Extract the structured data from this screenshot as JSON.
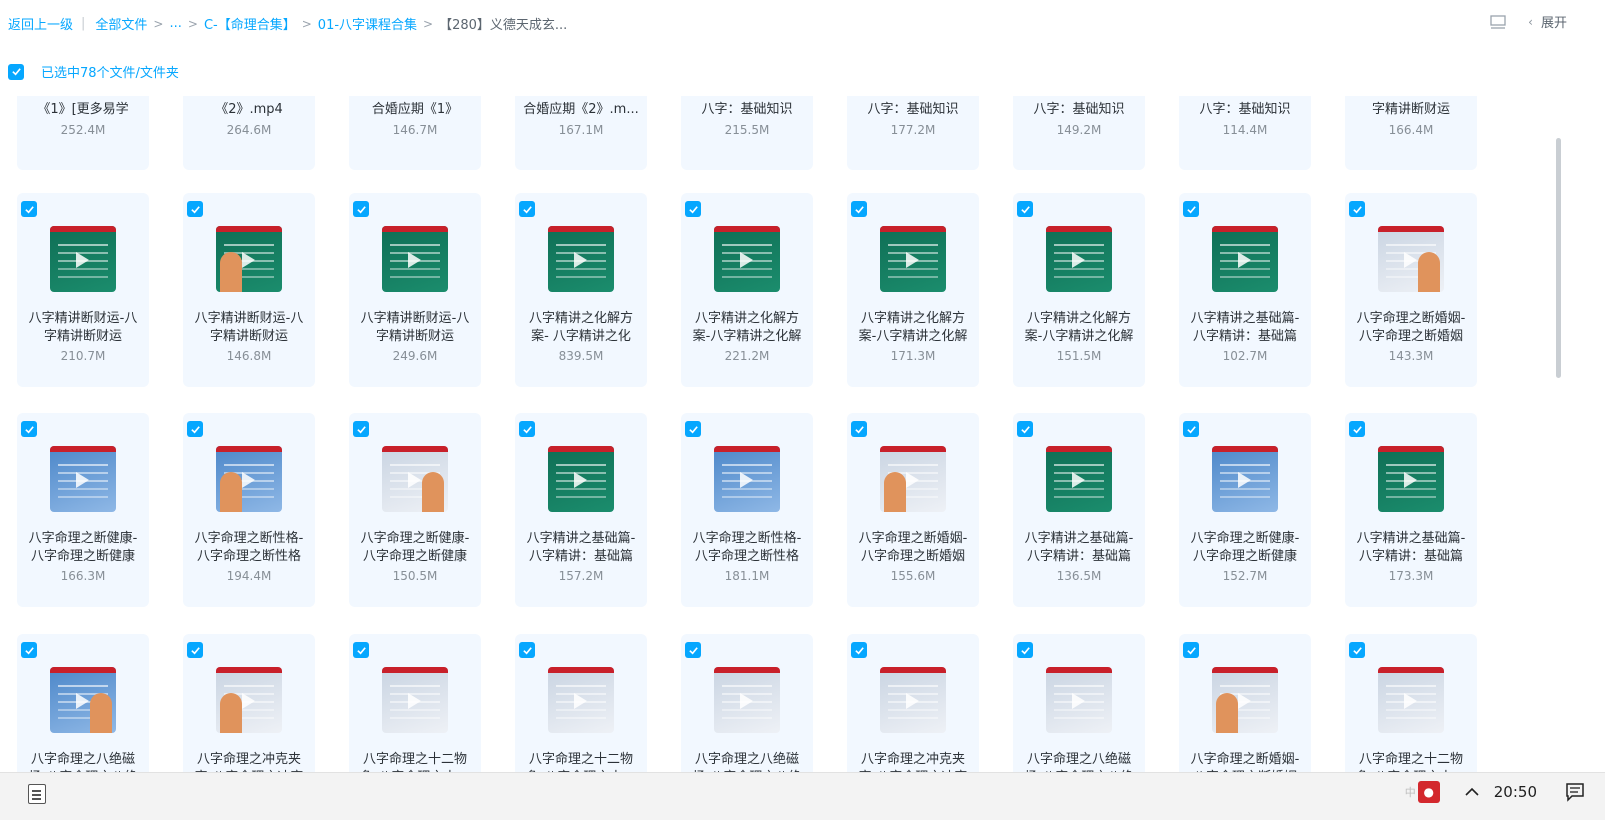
{
  "breadcrumb": {
    "back": "返回上一级",
    "separator": "|",
    "items": [
      "全部文件",
      "...",
      "C-【命理合集】",
      "01-八字课程合集",
      "【280】义德天成玄..."
    ]
  },
  "top_right": {
    "expand_label": "展开",
    "icons": [
      "list-view-icon",
      "chevron-left-icon"
    ]
  },
  "selection": {
    "checked": true,
    "text": "已选中78个文件/文件夹"
  },
  "colors": {
    "accent": "#06a7ff",
    "card_bg": "#f2f8ff",
    "text": "#2c3238",
    "muted": "#878f97"
  },
  "files": [
    {
      "name": "《1》[更多易学",
      "size": "252.4M",
      "thumb": "none"
    },
    {
      "name": "《2》.mp4",
      "size": "264.6M",
      "thumb": "none"
    },
    {
      "name": "合婚应期《1》",
      "size": "146.7M",
      "thumb": "none"
    },
    {
      "name": "合婚应期《2》.m...",
      "size": "167.1M",
      "thumb": "none"
    },
    {
      "name": "八字：基础知识",
      "size": "215.5M",
      "thumb": "none"
    },
    {
      "name": "八字：基础知识",
      "size": "177.2M",
      "thumb": "none"
    },
    {
      "name": "八字：基础知识",
      "size": "149.2M",
      "thumb": "none"
    },
    {
      "name": "八字：基础知识",
      "size": "114.4M",
      "thumb": "none"
    },
    {
      "name": "字精讲断财运",
      "size": "166.4M",
      "thumb": "none"
    },
    {
      "name": "八字精讲断财运-八字精讲断财运",
      "size": "210.7M",
      "thumb": "green"
    },
    {
      "name": "八字精讲断财运-八字精讲断财运",
      "size": "146.8M",
      "thumb": "green-person"
    },
    {
      "name": "八字精讲断财运-八字精讲断财运",
      "size": "249.6M",
      "thumb": "green"
    },
    {
      "name": "八字精讲之化解方案- 八字精讲之化",
      "size": "839.5M",
      "thumb": "green"
    },
    {
      "name": "八字精讲之化解方案-八字精讲之化解",
      "size": "221.2M",
      "thumb": "green"
    },
    {
      "name": "八字精讲之化解方案-八字精讲之化解",
      "size": "171.3M",
      "thumb": "green"
    },
    {
      "name": "八字精讲之化解方案-八字精讲之化解",
      "size": "151.5M",
      "thumb": "green"
    },
    {
      "name": "八字精讲之基础篇-八字精讲：基础篇",
      "size": "102.7M",
      "thumb": "green"
    },
    {
      "name": "八字命理之断婚姻-八字命理之断婚姻",
      "size": "143.3M",
      "thumb": "white-person"
    },
    {
      "name": "八字命理之断健康-八字命理之断健康",
      "size": "166.3M",
      "thumb": "blue"
    },
    {
      "name": "八字命理之断性格-八字命理之断性格",
      "size": "194.4M",
      "thumb": "blue-person"
    },
    {
      "name": "八字命理之断健康-八字命理之断健康",
      "size": "150.5M",
      "thumb": "white-person"
    },
    {
      "name": "八字精讲之基础篇-八字精讲：基础篇",
      "size": "157.2M",
      "thumb": "green"
    },
    {
      "name": "八字命理之断性格-八字命理之断性格",
      "size": "181.1M",
      "thumb": "blue"
    },
    {
      "name": "八字命理之断婚姻-八字命理之断婚姻",
      "size": "155.6M",
      "thumb": "white-person"
    },
    {
      "name": "八字精讲之基础篇-八字精讲：基础篇",
      "size": "136.5M",
      "thumb": "green"
    },
    {
      "name": "八字命理之断健康-八字命理之断健康",
      "size": "152.7M",
      "thumb": "blue"
    },
    {
      "name": "八字精讲之基础篇-八字精讲：基础篇",
      "size": "173.3M",
      "thumb": "green"
    },
    {
      "name": "八字命理之八绝磁场-八字命理之八绝",
      "size": "",
      "thumb": "blue-person"
    },
    {
      "name": "八字命理之冲克夹哀-八字命理之冲哀",
      "size": "",
      "thumb": "white-person"
    },
    {
      "name": "八字命理之十二物象-八字命理之十二",
      "size": "",
      "thumb": "white"
    },
    {
      "name": "八字命理之十二物象-八字命理之十二",
      "size": "",
      "thumb": "white"
    },
    {
      "name": "八字命理之八绝磁场-八字命理之八绝",
      "size": "",
      "thumb": "white"
    },
    {
      "name": "八字命理之冲克夹哀-八字命理之冲哀",
      "size": "",
      "thumb": "white"
    },
    {
      "name": "八字命理之八绝磁场-八字命理之八绝",
      "size": "",
      "thumb": "white"
    },
    {
      "name": "八字命理之断婚姻-八字命理之断婚姻",
      "size": "",
      "thumb": "white-person"
    },
    {
      "name": "八字命理之十二物象-八字命理之十二",
      "size": "",
      "thumb": "white"
    }
  ],
  "taskbar": {
    "ime": "中",
    "time": "20:50"
  }
}
